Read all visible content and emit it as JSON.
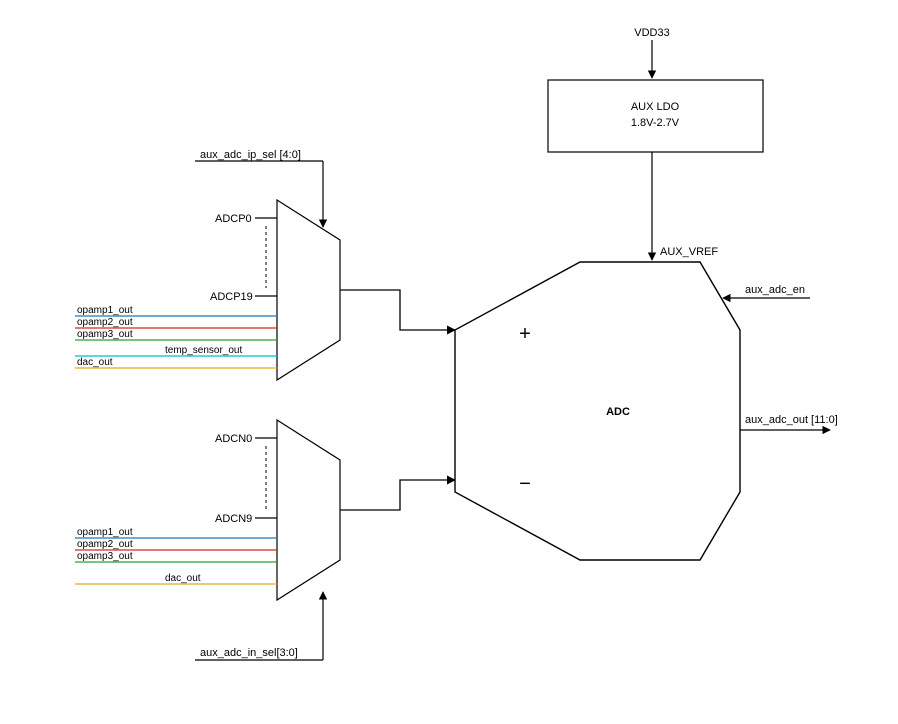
{
  "top": {
    "vdd_label": "VDD33",
    "ldo_title": "AUX LDO",
    "ldo_subtitle": "1.8V-2.7V",
    "vref_label": "AUX_VREF"
  },
  "sel": {
    "ip_sel": "aux_adc_ip_sel [4:0]",
    "in_sel": "aux_adc_in_sel[3:0]"
  },
  "mux_p": {
    "first": "ADCP0",
    "last": "ADCP19",
    "opamp1": "opamp1_out",
    "opamp2": "opamp2_out",
    "opamp3": "opamp3_out",
    "temp": "temp_sensor_out",
    "dac": "dac_out"
  },
  "mux_n": {
    "first": "ADCN0",
    "last": "ADCN9",
    "opamp1": "opamp1_out",
    "opamp2": "opamp2_out",
    "opamp3": "opamp3_out",
    "dac": "dac_out"
  },
  "adc": {
    "title": "ADC",
    "plus": "+",
    "minus": "−",
    "en": "aux_adc_en",
    "out": "aux_adc_out [11:0]"
  },
  "colors": {
    "opamp1": "#1f77b4",
    "opamp2": "#d62728",
    "opamp3": "#2ca02c",
    "temp": "#00bcd4",
    "dac": "#e6a817"
  }
}
